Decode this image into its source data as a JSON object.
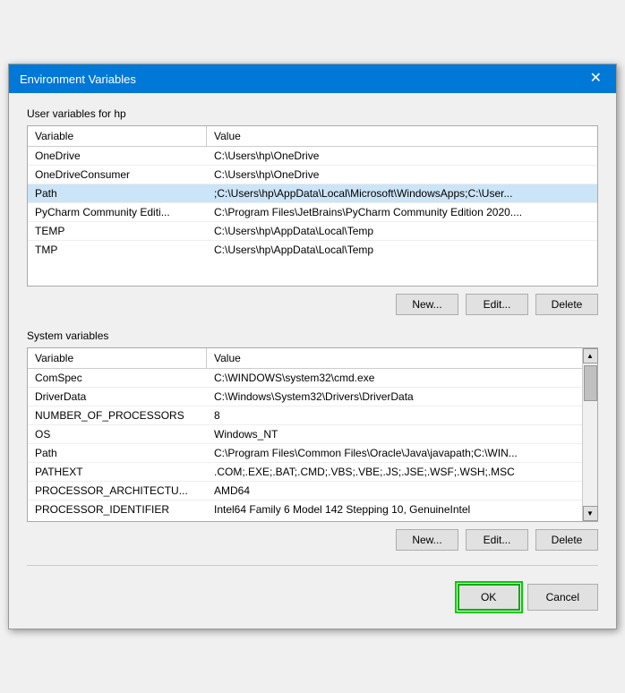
{
  "dialog": {
    "title": "Environment Variables",
    "close_label": "✕"
  },
  "user_section": {
    "label": "User variables for hp",
    "table": {
      "headers": [
        "Variable",
        "Value"
      ],
      "rows": [
        {
          "variable": "OneDrive",
          "value": "C:\\Users\\hp\\OneDrive",
          "selected": false
        },
        {
          "variable": "OneDriveConsumer",
          "value": "C:\\Users\\hp\\OneDrive",
          "selected": false
        },
        {
          "variable": "Path",
          "value": ";C:\\Users\\hp\\AppData\\Local\\Microsoft\\WindowsApps;C:\\User...",
          "selected": true
        },
        {
          "variable": "PyCharm Community Editi...",
          "value": "C:\\Program Files\\JetBrains\\PyCharm Community Edition 2020....",
          "selected": false
        },
        {
          "variable": "TEMP",
          "value": "C:\\Users\\hp\\AppData\\Local\\Temp",
          "selected": false
        },
        {
          "variable": "TMP",
          "value": "C:\\Users\\hp\\AppData\\Local\\Temp",
          "selected": false
        }
      ]
    },
    "buttons": {
      "new": "New...",
      "edit": "Edit...",
      "delete": "Delete"
    }
  },
  "system_section": {
    "label": "System variables",
    "table": {
      "headers": [
        "Variable",
        "Value"
      ],
      "rows": [
        {
          "variable": "ComSpec",
          "value": "C:\\WINDOWS\\system32\\cmd.exe",
          "selected": false
        },
        {
          "variable": "DriverData",
          "value": "C:\\Windows\\System32\\Drivers\\DriverData",
          "selected": false
        },
        {
          "variable": "NUMBER_OF_PROCESSORS",
          "value": "8",
          "selected": false
        },
        {
          "variable": "OS",
          "value": "Windows_NT",
          "selected": false
        },
        {
          "variable": "Path",
          "value": "C:\\Program Files\\Common Files\\Oracle\\Java\\javapath;C:\\WIN...",
          "selected": false
        },
        {
          "variable": "PATHEXT",
          "value": ".COM;.EXE;.BAT;.CMD;.VBS;.VBE;.JS;.JSE;.WSF;.WSH;.MSC",
          "selected": false
        },
        {
          "variable": "PROCESSOR_ARCHITECTU...",
          "value": "AMD64",
          "selected": false
        },
        {
          "variable": "PROCESSOR_IDENTIFIER",
          "value": "Intel64 Family 6 Model 142 Stepping 10, GenuineIntel",
          "selected": false
        }
      ]
    },
    "buttons": {
      "new": "New...",
      "edit": "Edit...",
      "delete": "Delete"
    }
  },
  "bottom_buttons": {
    "ok": "OK",
    "cancel": "Cancel"
  }
}
